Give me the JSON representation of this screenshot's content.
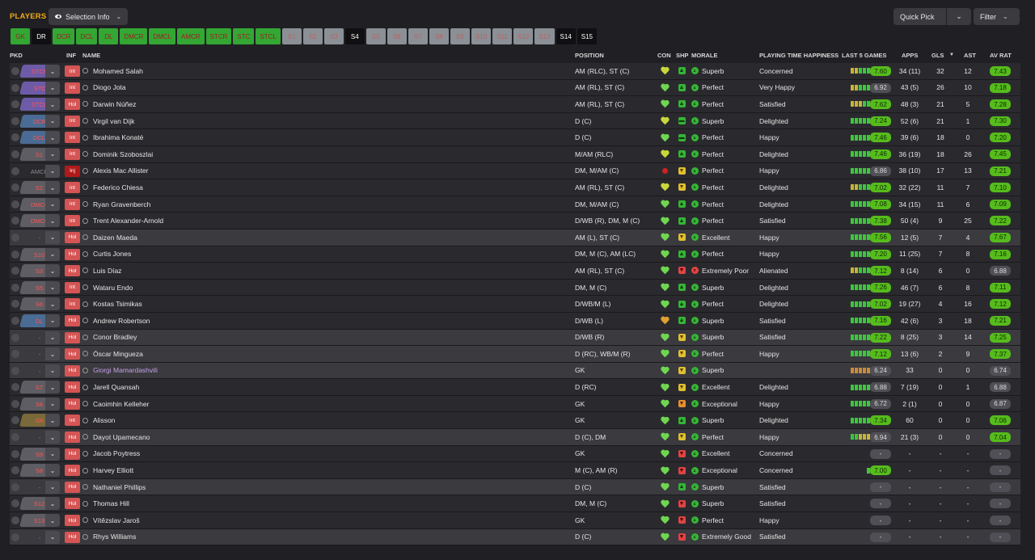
{
  "header": {
    "title": "PLAYERS",
    "selection_info_label": "Selection Info",
    "quick_pick_label": "Quick Pick",
    "filter_label": "Filter"
  },
  "positions": [
    {
      "label": "GK",
      "style": "green"
    },
    {
      "label": "DR",
      "style": "sel"
    },
    {
      "label": "DCR",
      "style": "green"
    },
    {
      "label": "DCL",
      "style": "green"
    },
    {
      "label": "DL",
      "style": "green"
    },
    {
      "label": "DMCR",
      "style": "green"
    },
    {
      "label": "DMCL",
      "style": "green"
    },
    {
      "label": "AMCR",
      "style": "green"
    },
    {
      "label": "STCR",
      "style": "green"
    },
    {
      "label": "STC",
      "style": "green"
    },
    {
      "label": "STCL",
      "style": "green"
    },
    {
      "label": "S1",
      "style": "grey"
    },
    {
      "label": "S2",
      "style": "grey"
    },
    {
      "label": "S3",
      "style": "grey"
    },
    {
      "label": "S4",
      "style": "sel"
    },
    {
      "label": "S5",
      "style": "grey"
    },
    {
      "label": "S6",
      "style": "grey"
    },
    {
      "label": "S7",
      "style": "grey"
    },
    {
      "label": "S8",
      "style": "grey"
    },
    {
      "label": "S9",
      "style": "grey"
    },
    {
      "label": "S10",
      "style": "grey"
    },
    {
      "label": "S11",
      "style": "grey"
    },
    {
      "label": "S12",
      "style": "grey"
    },
    {
      "label": "S13",
      "style": "grey"
    },
    {
      "label": "S14",
      "style": "sel"
    },
    {
      "label": "S15",
      "style": "sel"
    }
  ],
  "columns": {
    "pkd": "PKD",
    "inf": "INF",
    "name": "NAME",
    "position": "POSITION",
    "con": "CON",
    "shp": "SHP",
    "morale": "MORALE",
    "happiness": "PLAYING TIME HAPPINESS",
    "last5": "LAST 5 GAMES",
    "apps": "APPS",
    "gls": "GLS",
    "ast": "AST",
    "avrat": "AV RAT"
  },
  "players": [
    {
      "pkd": "STCR",
      "pkdc": "purple",
      "inf": "Int",
      "name": "Mohamed Salah",
      "pos": "AM (RLC), ST (C)",
      "con": "y",
      "shp": "g",
      "shps": "▲",
      "morale": "Superb",
      "happy": "Concerned",
      "bars": "yyggg",
      "last": "7.60",
      "lg": true,
      "apps": "34 (11)",
      "gls": "32",
      "ast": "12",
      "av": "7.43",
      "ag": true
    },
    {
      "pkd": "STC",
      "pkdc": "purple",
      "inf": "Int",
      "name": "Diogo Jota",
      "pos": "AM (RL), ST (C)",
      "con": "g",
      "shp": "g",
      "shps": "▲",
      "morale": "Perfect",
      "happy": "Very Happy",
      "bars": "yyggg",
      "last": "6.92",
      "lg": false,
      "apps": "43 (5)",
      "gls": "26",
      "ast": "10",
      "av": "7.18",
      "ag": true
    },
    {
      "pkd": "STCL",
      "pkdc": "purple",
      "inf": "Hol",
      "name": "Darwin Núñez",
      "pos": "AM (RL), ST (C)",
      "con": "g",
      "shp": "g",
      "shps": "▲",
      "morale": "Perfect",
      "happy": "Satisfied",
      "bars": "yyygg",
      "last": "7.62",
      "lg": true,
      "apps": "48 (3)",
      "gls": "21",
      "ast": "5",
      "av": "7.28",
      "ag": true
    },
    {
      "pkd": "DCR",
      "pkdc": "blue",
      "inf": "Int",
      "name": "Virgil van Dijk",
      "pos": "D (C)",
      "con": "y",
      "shp": "g",
      "shps": "▬",
      "morale": "Superb",
      "happy": "Delighted",
      "bars": "ggggg",
      "last": "7.24",
      "lg": true,
      "apps": "52 (6)",
      "gls": "21",
      "ast": "1",
      "av": "7.30",
      "ag": true
    },
    {
      "pkd": "DCL",
      "pkdc": "blue",
      "inf": "Int",
      "name": "Ibrahima Konaté",
      "pos": "D (C)",
      "con": "g",
      "shp": "g",
      "shps": "▬",
      "morale": "Perfect",
      "happy": "Happy",
      "bars": "ggggg",
      "last": "7.46",
      "lg": true,
      "apps": "39 (6)",
      "gls": "18",
      "ast": "0",
      "av": "7.20",
      "ag": true
    },
    {
      "pkd": "S1",
      "pkdc": "grey",
      "inf": "Int",
      "name": "Dominik Szoboszlai",
      "pos": "M/AM (RLC)",
      "con": "y",
      "shp": "g",
      "shps": "▲",
      "morale": "Perfect",
      "happy": "Delighted",
      "bars": "ggggg",
      "last": "7.46",
      "lg": true,
      "apps": "36 (19)",
      "gls": "18",
      "ast": "26",
      "av": "7.45",
      "ag": true
    },
    {
      "pkd": "AMCR",
      "pkdc": "none",
      "inf": "Inj",
      "name": "Alexis Mac Allister",
      "pos": "DM, M/AM (C)",
      "con": "inj",
      "shp": "y",
      "shps": "▼",
      "morale": "Perfect",
      "happy": "Happy",
      "bars": "ggggg",
      "last": "6.86",
      "lg": false,
      "apps": "38 (10)",
      "gls": "17",
      "ast": "13",
      "av": "7.21",
      "ag": true
    },
    {
      "pkd": "S2",
      "pkdc": "grey",
      "inf": "Int",
      "name": "Federico Chiesa",
      "pos": "AM (RL), ST (C)",
      "con": "y",
      "shp": "y",
      "shps": "▼",
      "morale": "Perfect",
      "happy": "Delighted",
      "bars": "yyggg",
      "last": "7.02",
      "lg": true,
      "apps": "32 (22)",
      "gls": "11",
      "ast": "7",
      "av": "7.10",
      "ag": true
    },
    {
      "pkd": "DMCR",
      "pkdc": "grey",
      "inf": "Int",
      "name": "Ryan Gravenberch",
      "pos": "DM, M/AM (C)",
      "con": "g",
      "shp": "g",
      "shps": "▲",
      "morale": "Perfect",
      "happy": "Delighted",
      "bars": "ggggg",
      "last": "7.08",
      "lg": true,
      "apps": "34 (15)",
      "gls": "11",
      "ast": "6",
      "av": "7.09",
      "ag": true
    },
    {
      "pkd": "DMCL",
      "pkdc": "grey",
      "inf": "Int",
      "name": "Trent Alexander-Arnold",
      "pos": "D/WB (R), DM, M (C)",
      "con": "g",
      "shp": "g",
      "shps": "▲",
      "morale": "Perfect",
      "happy": "Satisfied",
      "bars": "ggggg",
      "last": "7.38",
      "lg": true,
      "apps": "50 (4)",
      "gls": "9",
      "ast": "25",
      "av": "7.22",
      "ag": true
    },
    {
      "pkd": "-",
      "pkdc": "none",
      "inf": "Hol",
      "name": "Daizen Maeda",
      "pos": "AM (L), ST (C)",
      "con": "g",
      "shp": "y",
      "shps": "▼",
      "morale": "Excellent",
      "happy": "Happy",
      "bars": "ggggg",
      "last": "7.56",
      "lg": true,
      "apps": "12 (5)",
      "gls": "7",
      "ast": "4",
      "av": "7.67",
      "ag": true,
      "hl": true
    },
    {
      "pkd": "S10",
      "pkdc": "grey",
      "inf": "Hol",
      "name": "Curtis Jones",
      "pos": "DM, M (C), AM (LC)",
      "con": "g",
      "shp": "g",
      "shps": "▲",
      "morale": "Perfect",
      "happy": "Happy",
      "bars": "ggggg",
      "last": "7.20",
      "lg": true,
      "apps": "11 (25)",
      "gls": "7",
      "ast": "8",
      "av": "7.16",
      "ag": true
    },
    {
      "pkd": "S3",
      "pkdc": "grey",
      "inf": "Hol",
      "name": "Luis Díaz",
      "pos": "AM (RL), ST (C)",
      "con": "g",
      "shp": "r",
      "shps": "▼",
      "morale": "Extremely Poor",
      "happy": "Alienated",
      "bars": "yyggg",
      "last": "7.12",
      "lg": true,
      "apps": "8 (14)",
      "gls": "6",
      "ast": "0",
      "av": "6.88",
      "ag": false,
      "mbad": true
    },
    {
      "pkd": "S5",
      "pkdc": "grey",
      "inf": "Int",
      "name": "Wataru Endo",
      "pos": "DM, M (C)",
      "con": "g",
      "shp": "g",
      "shps": "▲",
      "morale": "Superb",
      "happy": "Delighted",
      "bars": "ggggg",
      "last": "7.26",
      "lg": true,
      "apps": "46 (7)",
      "gls": "6",
      "ast": "8",
      "av": "7.11",
      "ag": true
    },
    {
      "pkd": "S6",
      "pkdc": "grey",
      "inf": "Int",
      "name": "Kostas Tsimikas",
      "pos": "D/WB/M (L)",
      "con": "g",
      "shp": "g",
      "shps": "▲",
      "morale": "Perfect",
      "happy": "Delighted",
      "bars": "ggggg",
      "last": "7.02",
      "lg": true,
      "apps": "19 (27)",
      "gls": "4",
      "ast": "16",
      "av": "7.12",
      "ag": true
    },
    {
      "pkd": "DL",
      "pkdc": "blue",
      "inf": "Hol",
      "name": "Andrew Robertson",
      "pos": "D/WB (L)",
      "con": "o",
      "shp": "g",
      "shps": "▲",
      "morale": "Superb",
      "happy": "Satisfied",
      "bars": "ggggg",
      "last": "7.16",
      "lg": true,
      "apps": "42 (6)",
      "gls": "3",
      "ast": "18",
      "av": "7.21",
      "ag": true
    },
    {
      "pkd": "-",
      "pkdc": "none",
      "inf": "Hol",
      "name": "Conor Bradley",
      "pos": "D/WB (R)",
      "con": "g",
      "shp": "y",
      "shps": "▼",
      "morale": "Superb",
      "happy": "Satisfied",
      "bars": "ggggg",
      "last": "7.22",
      "lg": true,
      "apps": "8 (25)",
      "gls": "3",
      "ast": "14",
      "av": "7.25",
      "ag": true,
      "hl": true
    },
    {
      "pkd": "-",
      "pkdc": "none",
      "inf": "Hol",
      "name": "Óscar Mingueza",
      "pos": "D (RC), WB/M (R)",
      "con": "g",
      "shp": "y",
      "shps": "▼",
      "morale": "Perfect",
      "happy": "Happy",
      "bars": "ggggg",
      "last": "7.12",
      "lg": true,
      "apps": "13 (6)",
      "gls": "2",
      "ast": "9",
      "av": "7.37",
      "ag": true,
      "hl": true
    },
    {
      "pkd": "-",
      "pkdc": "none",
      "inf": "Hol",
      "name": "Giorgi Mamardashvili",
      "pos": "GK",
      "con": "g",
      "shp": "y",
      "shps": "▼",
      "morale": "Superb",
      "happy": "",
      "bars": "ooooo",
      "last": "6.24",
      "lg": false,
      "apps": "33",
      "gls": "0",
      "ast": "0",
      "av": "6.74",
      "ag": false,
      "hl": true,
      "gk": true
    },
    {
      "pkd": "S7",
      "pkdc": "grey",
      "inf": "Hol",
      "name": "Jarell Quansah",
      "pos": "D (RC)",
      "con": "g",
      "shp": "y",
      "shps": "▼",
      "morale": "Excellent",
      "happy": "Delighted",
      "bars": "ggggg",
      "last": "6.88",
      "lg": false,
      "apps": "7 (19)",
      "gls": "0",
      "ast": "1",
      "av": "6.88",
      "ag": false
    },
    {
      "pkd": "S8",
      "pkdc": "grey",
      "inf": "Hol",
      "name": "Caoimhin Kelleher",
      "pos": "GK",
      "con": "g",
      "shp": "o",
      "shps": "▼",
      "morale": "Exceptional",
      "happy": "Happy",
      "bars": "ggggg",
      "last": "6.72",
      "lg": false,
      "apps": "2 (1)",
      "gls": "0",
      "ast": "0",
      "av": "6.87",
      "ag": false
    },
    {
      "pkd": "GK",
      "pkdc": "olive",
      "inf": "Int",
      "name": "Alisson",
      "pos": "GK",
      "con": "g",
      "shp": "g",
      "shps": "▲",
      "morale": "Superb",
      "happy": "Delighted",
      "bars": "ggggg",
      "last": "7.34",
      "lg": true,
      "apps": "60",
      "gls": "0",
      "ast": "0",
      "av": "7.06",
      "ag": true
    },
    {
      "pkd": "-",
      "pkdc": "none",
      "inf": "Hol",
      "name": "Dayot Upamecano",
      "pos": "D (C), DM",
      "con": "g",
      "shp": "y",
      "shps": "▼",
      "morale": "Perfect",
      "happy": "Happy",
      "bars": "ggyyy",
      "last": "6.94",
      "lg": false,
      "apps": "21 (3)",
      "gls": "0",
      "ast": "0",
      "av": "7.04",
      "ag": true,
      "hl": true
    },
    {
      "pkd": "S9",
      "pkdc": "grey",
      "inf": "Hol",
      "name": "Jacob Poytress",
      "pos": "GK",
      "con": "g",
      "shp": "r",
      "shps": "▼",
      "morale": "Excellent",
      "happy": "Concerned",
      "bars": "",
      "last": "-",
      "lg": false,
      "apps": "-",
      "gls": "-",
      "ast": "-",
      "av": "-",
      "ag": false
    },
    {
      "pkd": "S8",
      "pkdc": "grey",
      "inf": "Hol",
      "name": "Harvey Elliott",
      "pos": "M (C), AM (R)",
      "con": "g",
      "shp": "r",
      "shps": "▼",
      "morale": "Exceptional",
      "happy": "Concerned",
      "bars": "g",
      "last": "7.00",
      "lg": true,
      "apps": "-",
      "gls": "-",
      "ast": "-",
      "av": "-",
      "ag": false
    },
    {
      "pkd": "-",
      "pkdc": "none",
      "inf": "Hol",
      "name": "Nathaniel Phillips",
      "pos": "D (C)",
      "con": "g",
      "shp": "g",
      "shps": "▲",
      "morale": "Superb",
      "happy": "Satisfied",
      "bars": "",
      "last": "-",
      "lg": false,
      "apps": "-",
      "gls": "-",
      "ast": "-",
      "av": "-",
      "ag": false,
      "hl": true
    },
    {
      "pkd": "S12",
      "pkdc": "grey",
      "inf": "Hol",
      "name": "Thomas Hill",
      "pos": "DM, M (C)",
      "con": "g",
      "shp": "r",
      "shps": "▼",
      "morale": "Superb",
      "happy": "Satisfied",
      "bars": "",
      "last": "-",
      "lg": false,
      "apps": "-",
      "gls": "-",
      "ast": "-",
      "av": "-",
      "ag": false
    },
    {
      "pkd": "S13",
      "pkdc": "grey",
      "inf": "Hol",
      "name": "Vítězslav Jaroš",
      "pos": "GK",
      "con": "g",
      "shp": "r",
      "shps": "▼",
      "morale": "Perfect",
      "happy": "Happy",
      "bars": "",
      "last": "-",
      "lg": false,
      "apps": "-",
      "gls": "-",
      "ast": "-",
      "av": "-",
      "ag": false
    },
    {
      "pkd": "-",
      "pkdc": "none",
      "inf": "Hol",
      "name": "Rhys Williams",
      "pos": "D (C)",
      "con": "g",
      "shp": "r",
      "shps": "▼",
      "morale": "Extremely Good",
      "happy": "Satisfied",
      "bars": "",
      "last": "-",
      "lg": false,
      "apps": "-",
      "gls": "-",
      "ast": "-",
      "av": "-",
      "ag": false,
      "hl": true
    }
  ]
}
